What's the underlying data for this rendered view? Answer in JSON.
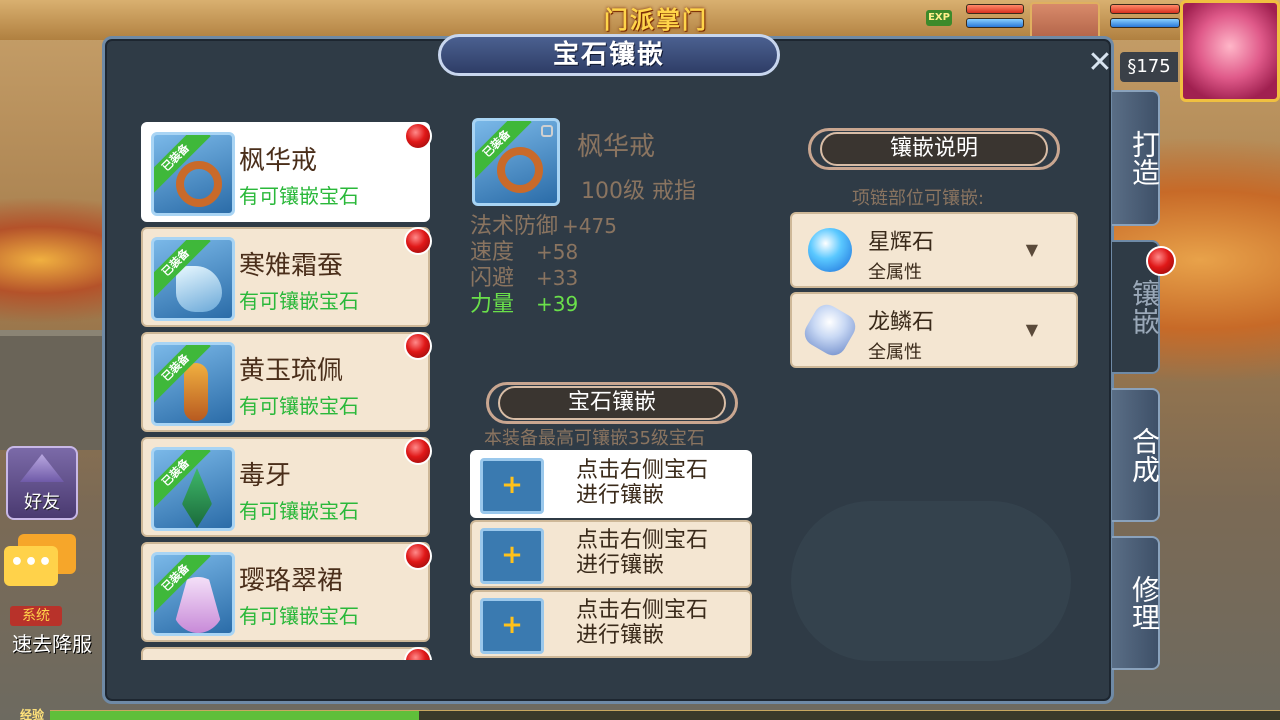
{
  "hud": {
    "banner": "门派掌门",
    "exp_badge": "EXP",
    "currency": "§175",
    "friend_label": "好友",
    "system_tag": "系统",
    "system_message": "速去降服",
    "exp_label": "经验"
  },
  "dialog": {
    "title": "宝石镶嵌"
  },
  "items": [
    {
      "name": "枫华戒",
      "status": "有可镶嵌宝石",
      "ribbon": "已装备"
    },
    {
      "name": "寒雉霜蚕",
      "status": "有可镶嵌宝石",
      "ribbon": "已装备"
    },
    {
      "name": "黄玉琉佩",
      "status": "有可镶嵌宝石",
      "ribbon": "已装备"
    },
    {
      "name": "毒牙",
      "status": "有可镶嵌宝石",
      "ribbon": "已装备"
    },
    {
      "name": "璎珞翠裙",
      "status": "有可镶嵌宝石",
      "ribbon": "已装备"
    }
  ],
  "detail": {
    "ribbon": "已装备",
    "name": "枫华戒",
    "level": "100级  戒指",
    "stats": [
      {
        "label": "法术防御",
        "value": "+475"
      },
      {
        "label": "速度",
        "value": "+58"
      },
      {
        "label": "闪避",
        "value": "+33"
      },
      {
        "label": "力量",
        "value": "+39"
      }
    ]
  },
  "socket_section": {
    "title": "宝石镶嵌",
    "hint": "本装备最高可镶嵌35级宝石",
    "slots": [
      {
        "plus": "+",
        "line1": "点击右侧宝石",
        "line2": "进行镶嵌"
      },
      {
        "plus": "+",
        "line1": "点击右侧宝石",
        "line2": "进行镶嵌"
      },
      {
        "plus": "+",
        "line1": "点击右侧宝石",
        "line2": "进行镶嵌"
      }
    ]
  },
  "gem_section": {
    "title": "镶嵌说明",
    "hint": "项链部位可镶嵌:",
    "gems": [
      {
        "name": "星辉石",
        "sub": "全属性",
        "arrow": "▼"
      },
      {
        "name": "龙鳞石",
        "sub": "全属性",
        "arrow": "▼"
      }
    ]
  },
  "tabs": [
    {
      "label": "打造"
    },
    {
      "label": "镶嵌"
    },
    {
      "label": "合成"
    },
    {
      "label": "修理"
    }
  ],
  "colors": {
    "panel_bg": "#2f3b46",
    "card_bg": "#f4e6d2",
    "status_green": "#2ab83a",
    "stat_highlight": "#6ae04a"
  }
}
